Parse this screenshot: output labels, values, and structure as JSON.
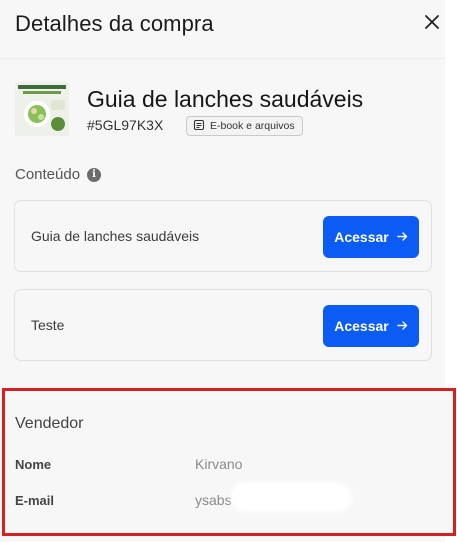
{
  "header": {
    "title": "Detalhes da compra",
    "close_icon": "close-icon"
  },
  "product": {
    "name": "Guia de lanches saudáveis",
    "code": "#5GL97K3X",
    "type_badge": "E-book e arquivos",
    "thumbnail_icon": "product-cover-image"
  },
  "content_section": {
    "label": "Conteúdo",
    "info_icon": "info-icon",
    "items": [
      {
        "label": "Guia de lanches saudáveis",
        "button": "Acessar"
      },
      {
        "label": "Teste",
        "button": "Acessar"
      }
    ]
  },
  "seller": {
    "title": "Vendedor",
    "name_label": "Nome",
    "name_value": "Kirvano",
    "email_label": "E-mail",
    "email_value": "ysabs"
  },
  "colors": {
    "accent": "#0a5cf5",
    "highlight_border": "#d42121",
    "panel_bg": "#f7f7f7"
  }
}
